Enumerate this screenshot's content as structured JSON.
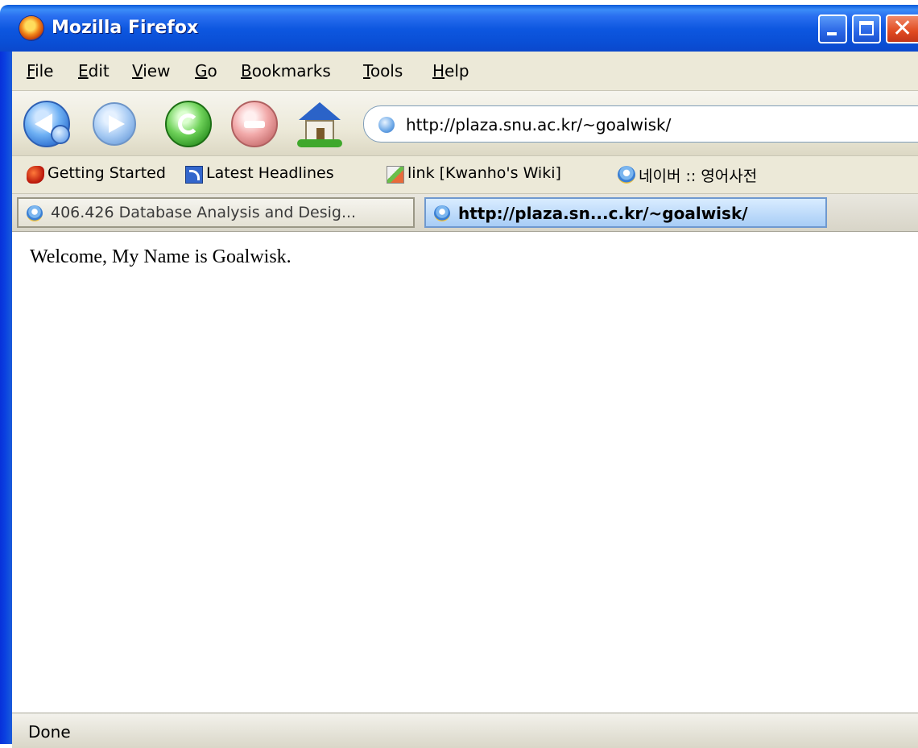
{
  "window": {
    "title": "Mozilla Firefox"
  },
  "menubar": {
    "items": [
      {
        "first": "F",
        "rest": "ile"
      },
      {
        "first": "E",
        "rest": "dit"
      },
      {
        "first": "V",
        "rest": "iew"
      },
      {
        "first": "G",
        "rest": "o"
      },
      {
        "first": "B",
        "rest": "ookmarks"
      },
      {
        "first": "T",
        "rest": "ools"
      },
      {
        "first": "H",
        "rest": "elp"
      }
    ]
  },
  "navbar": {
    "url": "http://plaza.snu.ac.kr/~goalwisk/"
  },
  "bookmarks": {
    "items": [
      {
        "label": "Getting Started",
        "icon": "firefox-bookmark-icon"
      },
      {
        "label": "Latest Headlines",
        "icon": "rss-icon"
      },
      {
        "label": "link [Kwanho's Wiki]",
        "icon": "wiki-icon"
      },
      {
        "label": "네이버 :: 영어사전",
        "icon": "page-icon"
      }
    ]
  },
  "tabs": [
    {
      "label": "406.426 Database Analysis and Desig...",
      "active": false
    },
    {
      "label": "http://plaza.sn...c.kr/~goalwisk/",
      "active": true
    }
  ],
  "content": {
    "welcome_text": "Welcome, My Name is Goalwisk."
  },
  "status": {
    "text": "Done"
  },
  "colors": {
    "titlebar": "#0a4fd6",
    "chrome": "#ece9d8",
    "active_tab": "#a8cdf6"
  }
}
